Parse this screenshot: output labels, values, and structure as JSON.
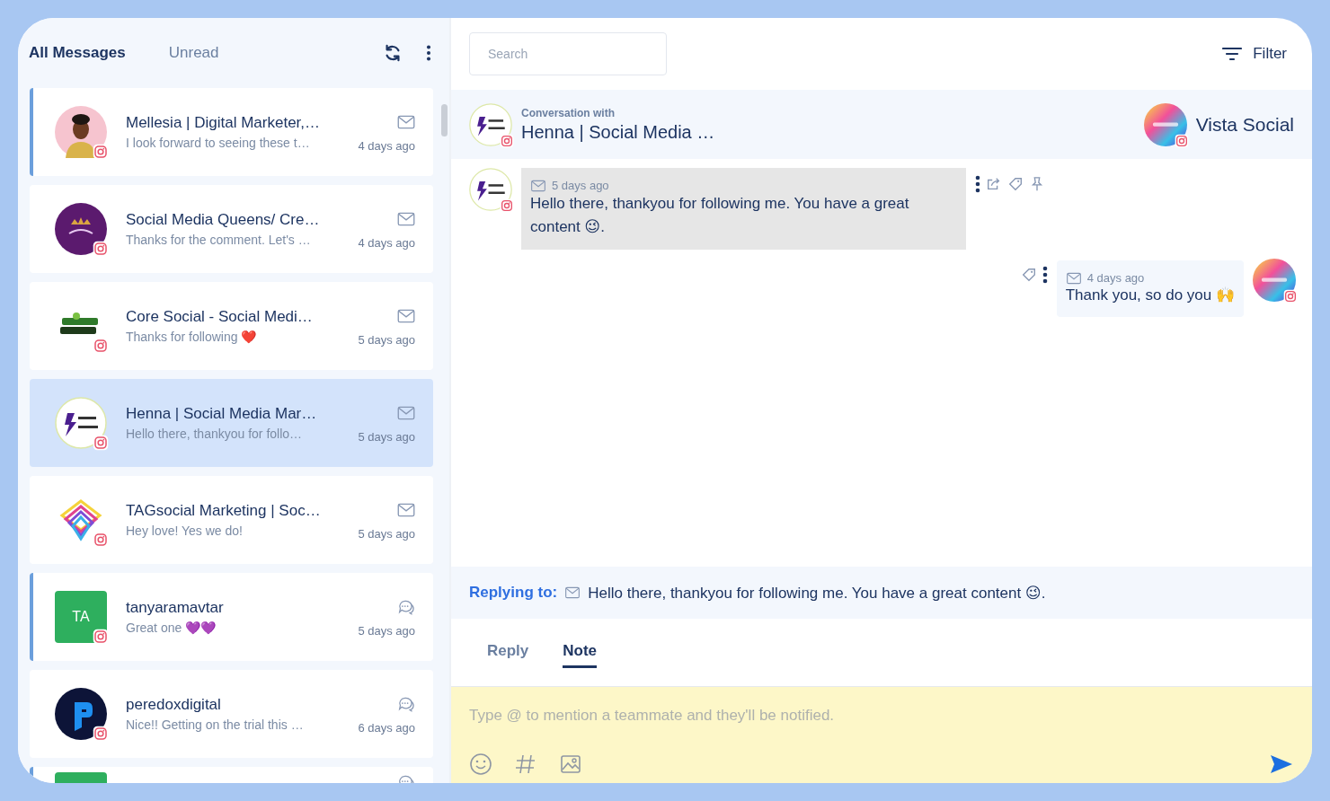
{
  "list_tabs": [
    {
      "label": "All Messages",
      "selected": true
    },
    {
      "label": "Unread",
      "selected": false
    }
  ],
  "conversations": [
    {
      "name": "Mellesia | Digital Marketer,…",
      "preview": "I look forward to seeing these t…",
      "time": "4 days ago",
      "icon": {
        "kind": "mail"
      },
      "unread": true,
      "selected": false
    },
    {
      "name": "Social Media Queens/ Cre…",
      "preview": "Thanks for the comment. Let's …",
      "time": "4 days ago",
      "avatar": {
        "kind": "crown"
      },
      "icon": {
        "kind": "mail"
      },
      "unread": false,
      "selected": false
    },
    {
      "name": "Core Social - Social Medi…",
      "preview": "Thanks for following ❤️",
      "time": "5 days ago",
      "avatar": {
        "kind": "wordmark"
      },
      "icon": {
        "kind": "mail"
      },
      "unread": false,
      "selected": false
    },
    {
      "name": "Henna | Social Media Mar…",
      "preview": "Hello there, thankyou for follo…",
      "time": "5 days ago",
      "avatar": {
        "kind": "lightning"
      },
      "icon": {
        "kind": "mail"
      },
      "unread": false,
      "selected": true
    },
    {
      "name": "TAGsocial Marketing | Soc…",
      "preview": "Hey love! Yes we do!",
      "time": "5 days ago",
      "avatar": {
        "kind": "diamond"
      },
      "icon": {
        "kind": "mail"
      },
      "unread": false,
      "selected": false
    },
    {
      "name": "tanyaramavtar",
      "preview": "Great one 💜💜",
      "time": "5 days ago",
      "avatar": {
        "kind": "initials",
        "text": "TA"
      },
      "icon": {
        "kind": "comment"
      },
      "unread": true,
      "selected": false
    },
    {
      "name": "peredoxdigital",
      "preview": "Nice!! Getting on the trial this …",
      "time": "6 days ago",
      "avatar": {
        "kind": "letter"
      },
      "icon": {
        "kind": "comment"
      },
      "unread": false,
      "selected": false
    },
    {
      "avatar": {
        "kind": "initials"
      },
      "icon": {
        "kind": "comment"
      },
      "unread": true,
      "selected": false
    }
  ],
  "search": {
    "placeholder": "Search"
  },
  "filter_button": "Filter",
  "conversation_header": {
    "caption": "Conversation with",
    "contact": "Henna | Social Media …",
    "contact_avatar": {
      "kind": "lightning"
    },
    "account": "Vista Social",
    "account_avatar": {
      "kind": "rainbow"
    }
  },
  "messages": [
    {
      "kind": "incoming",
      "avatar": {
        "kind": "lightning"
      },
      "time": "5 days ago",
      "text": "Hello there, thankyou for following me. You have a great content 😉."
    },
    {
      "kind": "outgoing",
      "avatar": {
        "kind": "rainbow"
      },
      "time": "4 days ago",
      "text": "Thank you, so do you 🙌"
    }
  ],
  "replying_to": {
    "label": "Replying to:",
    "text": "Hello there, thankyou for following me. You have a great content 😉."
  },
  "composer_tabs": [
    {
      "label": "Reply",
      "selected": false
    },
    {
      "label": "Note",
      "selected": true
    }
  ],
  "composer": {
    "placeholder": "Type @ to mention a teammate and they'll be notified.",
    "kind": "note"
  }
}
